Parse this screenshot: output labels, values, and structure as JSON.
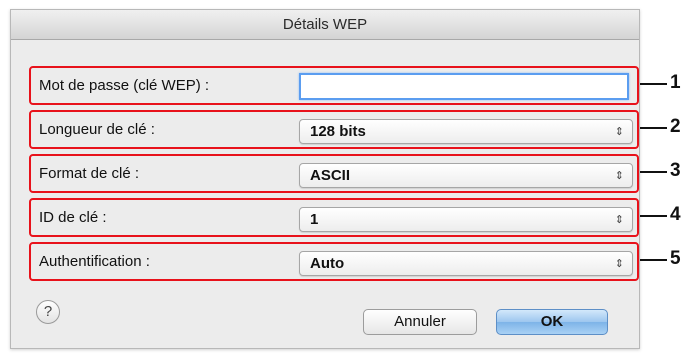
{
  "dialog": {
    "title": "Détails WEP"
  },
  "rows": [
    {
      "label": "Mot de passe (clé WEP) :",
      "type": "text",
      "value": "",
      "callout": "1"
    },
    {
      "label": "Longueur de clé :",
      "type": "popup",
      "value": "128 bits",
      "callout": "2"
    },
    {
      "label": "Format de clé :",
      "type": "popup",
      "value": "ASCII",
      "callout": "3"
    },
    {
      "label": "ID de clé :",
      "type": "popup",
      "value": "1",
      "callout": "4"
    },
    {
      "label": "Authentification :",
      "type": "popup",
      "value": "Auto",
      "callout": "5"
    }
  ],
  "buttons": {
    "help": "?",
    "cancel": "Annuler",
    "ok": "OK"
  },
  "icons": {
    "popup_arrows": "⇕",
    "help": "question-mark-icon"
  },
  "colors": {
    "highlight_border": "#e8121b",
    "focus_ring": "#5b9df0",
    "default_button": "#9dc6ef"
  }
}
